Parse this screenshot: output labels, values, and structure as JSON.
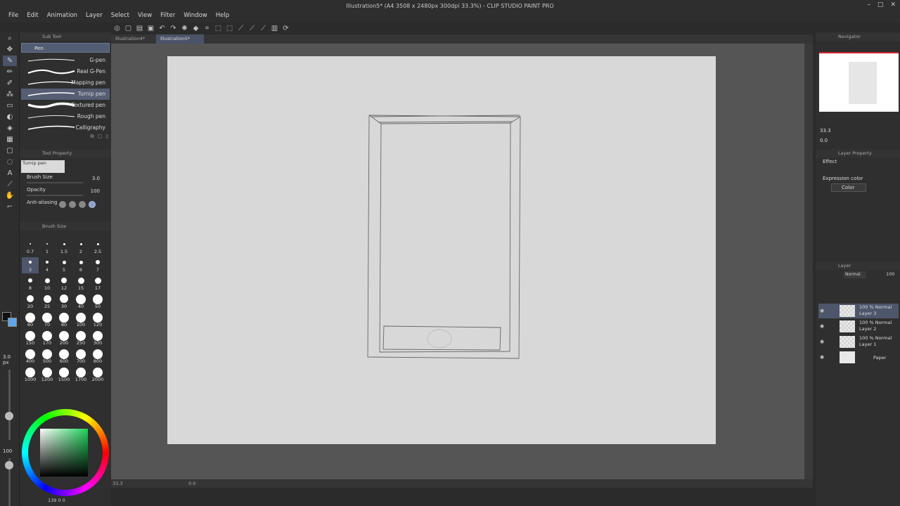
{
  "window": {
    "title": "Illustration5* (A4 3508 x 2480px 300dpi 33.3%) - CLIP STUDIO PAINT PRO"
  },
  "menu": [
    "File",
    "Edit",
    "Animation",
    "Layer",
    "Select",
    "View",
    "Filter",
    "Window",
    "Help"
  ],
  "doc_tabs": [
    {
      "label": "Illustration4*",
      "active": false
    },
    {
      "label": "Illustration5*",
      "active": true
    }
  ],
  "subtool": {
    "panel_title": "Sub Tool",
    "group": "Pen",
    "brushes": [
      {
        "name": "G-pen",
        "selected": false
      },
      {
        "name": "Real G-Pen",
        "selected": false
      },
      {
        "name": "Mapping pen",
        "selected": false
      },
      {
        "name": "Turnip pen",
        "selected": true
      },
      {
        "name": "Textured pen",
        "selected": false
      },
      {
        "name": "Rough pen",
        "selected": false
      },
      {
        "name": "Calligraphy",
        "selected": false
      }
    ]
  },
  "tool_property": {
    "panel_title": "Tool Property",
    "current": "Turnip pen",
    "brush_size_label": "Brush Size",
    "brush_size_value": "3.0",
    "opacity_label": "Opacity",
    "opacity_value": "100",
    "antialias_label": "Anti-aliasing"
  },
  "brush_size_panel": {
    "title": "Brush Size",
    "sizes": [
      "0.7",
      "1",
      "1.5",
      "2",
      "2.5",
      "3",
      "4",
      "5",
      "6",
      "7",
      "8",
      "10",
      "12",
      "15",
      "17",
      "20",
      "25",
      "30",
      "40",
      "50",
      "60",
      "70",
      "80",
      "100",
      "120",
      "150",
      "170",
      "200",
      "250",
      "300",
      "400",
      "500",
      "600",
      "700",
      "800",
      "1000",
      "1200",
      "1500",
      "1700",
      "2000"
    ],
    "selected": "3"
  },
  "toolstrip": {
    "size_readout": "3.0\npx",
    "opacity_readout": "100"
  },
  "color": {
    "foreground": "#111111",
    "background": "#5fa6e8",
    "values": "139  0  0"
  },
  "status": {
    "zoom": "33.3",
    "rotation": "0.0"
  },
  "navigator": {
    "title": "Navigator",
    "zoom": "33.3",
    "rotation": "0.0"
  },
  "layer_property": {
    "title": "Layer Property",
    "effect_label": "Effect",
    "expression_color_label": "Expression color",
    "expression_color_value": "Color"
  },
  "layers": {
    "title": "Layer",
    "blend_mode": "Normal",
    "opacity": "100",
    "items": [
      {
        "mode": "100 % Normal",
        "name": "Layer 3",
        "selected": true
      },
      {
        "mode": "100 % Normal",
        "name": "Layer 2",
        "selected": false
      },
      {
        "mode": "100 % Normal",
        "name": "Layer 1",
        "selected": false
      },
      {
        "mode": "",
        "name": "Paper",
        "selected": false
      }
    ]
  }
}
